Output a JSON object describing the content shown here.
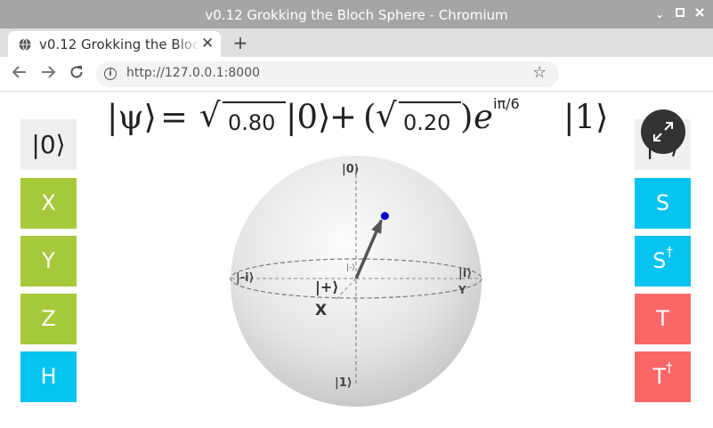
{
  "window": {
    "title": "v0.12 Grokking the Bloch Sphere - Chromium",
    "controls": [
      "minimize-icon",
      "maximize-icon",
      "close-icon"
    ]
  },
  "tabs": [
    {
      "title": "v0.12 Grokking the Bloch Sphere",
      "active": true
    }
  ],
  "toolbar": {
    "url": "http://127.0.0.1:8000",
    "icons": [
      "back-icon",
      "forward-icon",
      "reload-icon",
      "info-icon",
      "bookmark-star-icon",
      "extension-h-icon",
      "ublock-icon",
      "extensions-puzzle-icon",
      "profile-icon",
      "menu-icon"
    ]
  },
  "equation": {
    "ket_psi": "|ψ⟩",
    "equals": "=",
    "sqrt": "√",
    "amp0": "0.80",
    "ket0": "|0⟩",
    "plus": "+",
    "paren_open": "(",
    "amp1": "0.20",
    "paren_close": ")",
    "e": "e",
    "phase": "iπ/6",
    "ket1": "|1⟩"
  },
  "left_gates": [
    {
      "label": "|0⟩",
      "color": "gray"
    },
    {
      "label": "X",
      "color": "green"
    },
    {
      "label": "Y",
      "color": "green"
    },
    {
      "label": "Z",
      "color": "green"
    },
    {
      "label": "H",
      "color": "cyan"
    }
  ],
  "right_gates": [
    {
      "label": "|1⟩",
      "color": "gray"
    },
    {
      "label": "S",
      "color": "cyan"
    },
    {
      "label": "S",
      "sup": "†",
      "color": "cyan"
    },
    {
      "label": "T",
      "color": "red"
    },
    {
      "label": "T",
      "sup": "†",
      "color": "red"
    }
  ],
  "sphere": {
    "labels": {
      "top": "|0⟩",
      "bottom": "|1⟩",
      "left": "|-i⟩",
      "right": "|i⟩",
      "plus": "|+⟩",
      "minus_back": "|-⟩",
      "x_axis": "X",
      "y_axis": "Y"
    },
    "state": {
      "theta_deg": 53.13,
      "phi_deg": 30
    },
    "colors": {
      "vector": "#555555",
      "tip": "#0000cc"
    }
  },
  "colors": {
    "green": "#a5c93a",
    "cyan": "#07c3f0",
    "red": "#fb6767",
    "gray": "#efefef"
  }
}
